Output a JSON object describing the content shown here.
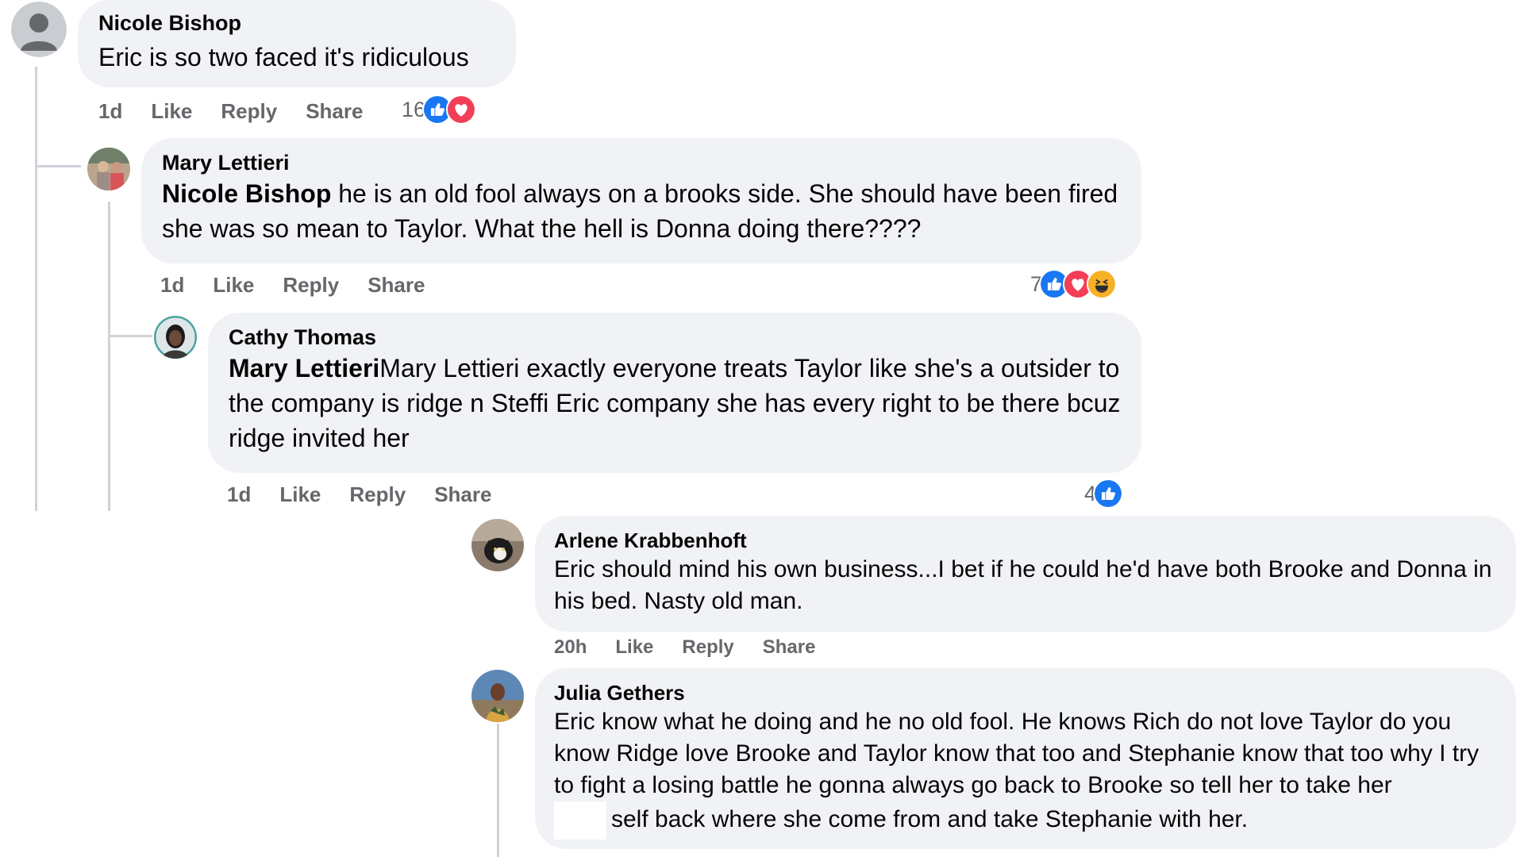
{
  "colors": {
    "bubble": "#f0f2f5",
    "secondary_text": "#65676b",
    "like_blue": "#1877f2",
    "love_red": "#f33e58",
    "haha_yellow": "#f7b125"
  },
  "comments": [
    {
      "author": "Nicole Bishop",
      "mention": "",
      "text": "Eric is so two faced it's ridiculous",
      "time": "1d",
      "like": "Like",
      "reply": "Reply",
      "share": "Share",
      "reaction_count": "16",
      "reactions": [
        "like-icon",
        "love-icon"
      ]
    },
    {
      "author": "Mary Lettieri",
      "mention": "Nicole Bishop",
      "text": " he is an old fool always on a brooks side. She should have been fired she was so mean to Taylor. What the hell is Donna doing there????",
      "time": "1d",
      "like": "Like",
      "reply": "Reply",
      "share": "Share",
      "reaction_count": "7",
      "reactions": [
        "like-icon",
        "love-icon",
        "haha-icon"
      ]
    },
    {
      "author": "Cathy Thomas",
      "mention": "Mary Lettieri",
      "text": "Mary Lettieri exactly everyone treats Taylor like she's a outsider to the company is ridge n Steffi Eric company she has every right to be there bcuz ridge invited her",
      "time": "1d",
      "like": "Like",
      "reply": "Reply",
      "share": "Share",
      "reaction_count": "4",
      "reactions": [
        "like-icon"
      ]
    },
    {
      "author": "Arlene Krabbenhoft",
      "mention": "",
      "text": "Eric should mind his own business...I bet if he could he'd have both Brooke and Donna in his bed. Nasty old man.",
      "time": "20h",
      "like": "Like",
      "reply": "Reply",
      "share": "Share",
      "reaction_count": "",
      "reactions": []
    },
    {
      "author": "Julia Gethers",
      "mention": "",
      "text": "Eric know what he doing and he no old fool. He knows Rich do not love Taylor do you know Ridge love Brooke and Taylor know that too and Stephanie know that too why I try to fight a losing battle he gonna always go back to Brooke so tell her to take her",
      "text_tail": "self back where she come from and take Stephanie with her.",
      "time": "",
      "like": "",
      "reply": "",
      "share": "",
      "reaction_count": "",
      "reactions": []
    }
  ]
}
